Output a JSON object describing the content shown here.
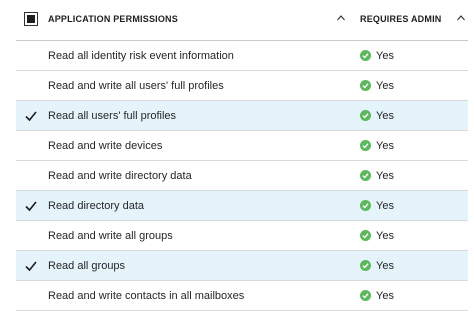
{
  "header": {
    "permission_label": "APPLICATION PERMISSIONS",
    "admin_label": "REQUIRES ADMIN"
  },
  "colors": {
    "selected_row": "#e5f3fb",
    "check_green": "#5cb85c",
    "checkbox_check": "#1e1e1e"
  },
  "rows": [
    {
      "label": "Read all identity risk event information",
      "admin": "Yes",
      "checked": false
    },
    {
      "label": "Read and write all users' full profiles",
      "admin": "Yes",
      "checked": false
    },
    {
      "label": "Read all users' full profiles",
      "admin": "Yes",
      "checked": true
    },
    {
      "label": "Read and write devices",
      "admin": "Yes",
      "checked": false
    },
    {
      "label": "Read and write directory data",
      "admin": "Yes",
      "checked": false
    },
    {
      "label": "Read directory data",
      "admin": "Yes",
      "checked": true
    },
    {
      "label": "Read and write all groups",
      "admin": "Yes",
      "checked": false
    },
    {
      "label": "Read all groups",
      "admin": "Yes",
      "checked": true
    },
    {
      "label": "Read and write contacts in all mailboxes",
      "admin": "Yes",
      "checked": false
    }
  ]
}
